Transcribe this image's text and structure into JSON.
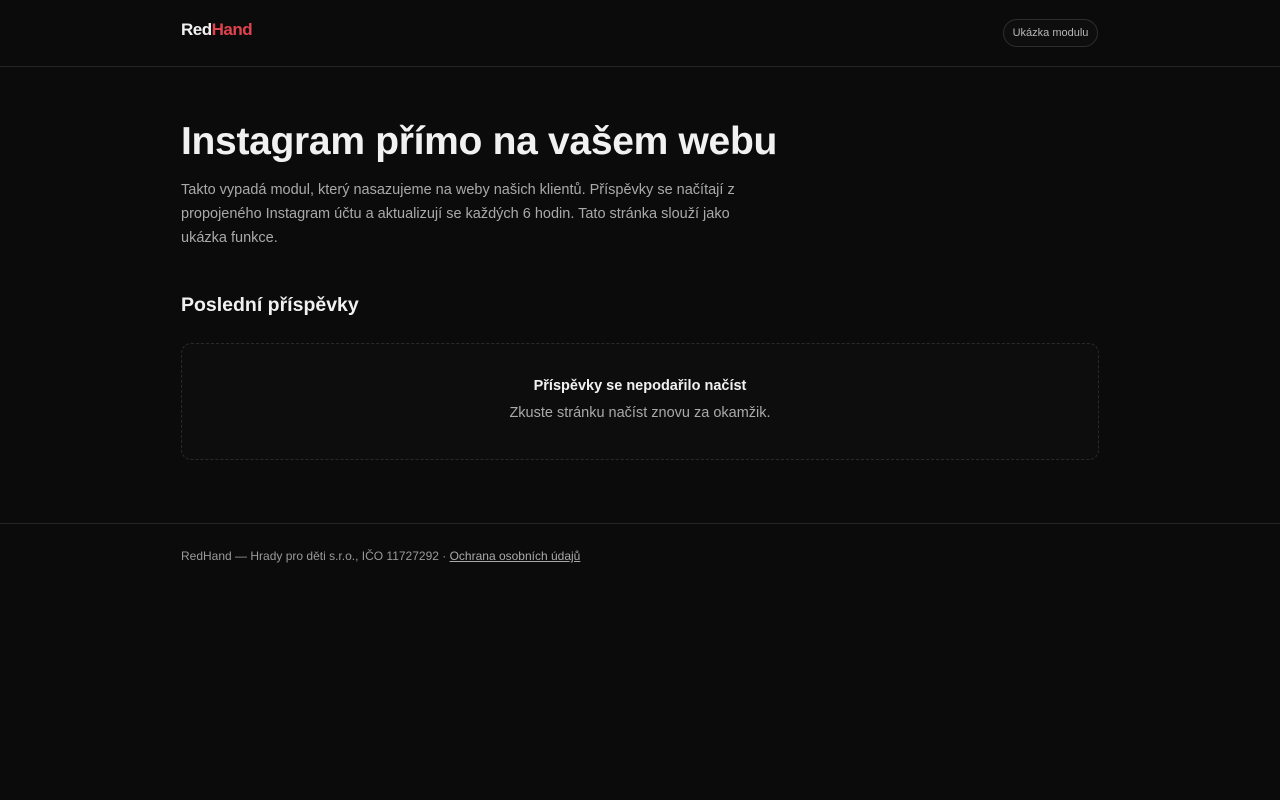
{
  "brand": {
    "part_a": "Red",
    "part_b": "Hand",
    "colors": {
      "part_a": "#f2f2f2",
      "part_b": "#e0434e"
    }
  },
  "header": {
    "demo_button_label": "Ukázka modulu"
  },
  "hero": {
    "title": "Instagram přímo na vašem webu",
    "description": "Takto vypadá modul, který nasazujeme na weby našich klientů. Příspěvky se načítají z propojeného Instagram účtu a aktualizují se každých 6 hodin. Tato stránka slouží jako ukázka funkce."
  },
  "posts": {
    "section_title": "Poslední příspěvky",
    "error_title": "Příspěvky se nepodařilo načíst",
    "error_text": "Zkuste stránku načíst znovu za okamžik."
  },
  "footer": {
    "company_text": "RedHand — Hrady pro děti s.r.o., IČO 11727292 · ",
    "privacy_link": "Ochrana osobních údajů"
  },
  "colors": {
    "background": "#0b0b0b",
    "text": "#ededed",
    "muted": "#a9a9a9",
    "accent": "#e0434e"
  }
}
